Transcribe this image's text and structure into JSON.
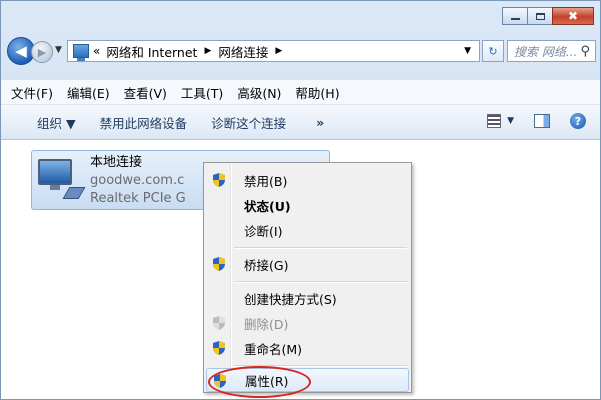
{
  "window": {
    "caption": {
      "minimize_icon": "minimize-icon",
      "maximize_icon": "maximize-icon",
      "close_glyph": "✖"
    }
  },
  "nav": {
    "back_glyph": "◀",
    "forward_glyph": "▶",
    "history_glyph": "▼",
    "address": {
      "overflow": "«",
      "crumbs": [
        "网络和 Internet",
        "网络连接"
      ],
      "separator": "▶",
      "dropdown_glyph": "▼"
    },
    "refresh_glyph": "↻",
    "search_placeholder": "搜索 网络...",
    "search_glyph": "⚲"
  },
  "menu_bar": {
    "items": [
      "文件(F)",
      "编辑(E)",
      "查看(V)",
      "工具(T)",
      "高级(N)",
      "帮助(H)"
    ]
  },
  "command_bar": {
    "organize": "组织 ▼",
    "disable_device": "禁用此网络设备",
    "diagnose": "诊断这个连接",
    "more": "»",
    "view_drop_glyph": "▼",
    "help_glyph": "?"
  },
  "connection": {
    "name": "本地连接",
    "network": "goodwe.com.c",
    "adapter": "Realtek PCIe G"
  },
  "context_menu": {
    "items": [
      {
        "label": "禁用(B)",
        "icon": "shield-icon"
      },
      {
        "label": "状态(U)"
      },
      {
        "label": "诊断(I)"
      },
      {
        "label": "桥接(G)",
        "icon": "shield-icon"
      },
      {
        "label": "创建快捷方式(S)"
      },
      {
        "label": "删除(D)",
        "icon": "shield-icon",
        "disabled": true
      },
      {
        "label": "重命名(M)",
        "icon": "shield-icon"
      },
      {
        "label": "属性(R)",
        "icon": "shield-icon",
        "highlighted": true
      }
    ]
  },
  "colors": {
    "highlight_ring": "#d7261c",
    "shield_blue": "#2a63c4",
    "shield_yellow": "#f2c318"
  }
}
